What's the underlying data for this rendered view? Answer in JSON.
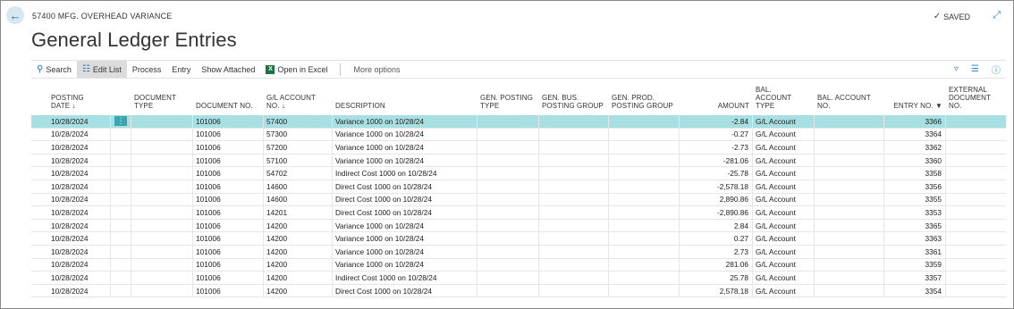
{
  "breadcrumb": "57400 MFG. OVERHEAD VARIANCE",
  "status": "SAVED",
  "page_title": "General Ledger Entries",
  "actions": {
    "search": "Search",
    "edit_list": "Edit List",
    "process": "Process",
    "entry": "Entry",
    "show_attached": "Show Attached",
    "open_in_excel": "Open in Excel",
    "more_options": "More options"
  },
  "columns": {
    "posting_date_1": "POSTING",
    "posting_date_2": "DATE ↓",
    "document_type_1": "DOCUMENT",
    "document_type_2": "TYPE",
    "document_no": "DOCUMENT NO.",
    "gl_account_1": "G/L ACCOUNT",
    "gl_account_2": "NO. ↓",
    "description": "DESCRIPTION",
    "gen_posting_1": "GEN. POSTING",
    "gen_posting_2": "TYPE",
    "gen_bus_1": "GEN. BUS.",
    "gen_bus_2": "POSTING GROUP",
    "gen_prod_1": "GEN. PROD.",
    "gen_prod_2": "POSTING GROUP",
    "amount": "AMOUNT",
    "bal_account_type_1": "BAL.",
    "bal_account_type_2": "ACCOUNT",
    "bal_account_type_3": "TYPE",
    "bal_account_no_1": "BAL. ACCOUNT",
    "bal_account_no_2": "NO.",
    "entry_no": "ENTRY NO.",
    "external_doc_1": "EXTERNAL",
    "external_doc_2": "DOCUMENT",
    "external_doc_3": "NO."
  },
  "rows": [
    {
      "posting_date": "10/28/2024",
      "document_type": "",
      "document_no": "101006",
      "gl_account": "57400",
      "description": "Variance 1000 on 10/28/24",
      "gen_posting_type": "",
      "gen_bus": "",
      "gen_prod": "",
      "amount": "-2.84",
      "bal_account_type": "G/L Account",
      "bal_account_no": "",
      "entry_no": "3366",
      "external_doc": ""
    },
    {
      "posting_date": "10/28/2024",
      "document_type": "",
      "document_no": "101006",
      "gl_account": "57300",
      "description": "Variance 1000 on 10/28/24",
      "gen_posting_type": "",
      "gen_bus": "",
      "gen_prod": "",
      "amount": "-0.27",
      "bal_account_type": "G/L Account",
      "bal_account_no": "",
      "entry_no": "3364",
      "external_doc": ""
    },
    {
      "posting_date": "10/28/2024",
      "document_type": "",
      "document_no": "101006",
      "gl_account": "57200",
      "description": "Variance 1000 on 10/28/24",
      "gen_posting_type": "",
      "gen_bus": "",
      "gen_prod": "",
      "amount": "-2.73",
      "bal_account_type": "G/L Account",
      "bal_account_no": "",
      "entry_no": "3362",
      "external_doc": ""
    },
    {
      "posting_date": "10/28/2024",
      "document_type": "",
      "document_no": "101006",
      "gl_account": "57100",
      "description": "Variance 1000 on 10/28/24",
      "gen_posting_type": "",
      "gen_bus": "",
      "gen_prod": "",
      "amount": "-281.06",
      "bal_account_type": "G/L Account",
      "bal_account_no": "",
      "entry_no": "3360",
      "external_doc": ""
    },
    {
      "posting_date": "10/28/2024",
      "document_type": "",
      "document_no": "101006",
      "gl_account": "54702",
      "description": "Indirect Cost 1000 on 10/28/24",
      "gen_posting_type": "",
      "gen_bus": "",
      "gen_prod": "",
      "amount": "-25.78",
      "bal_account_type": "G/L Account",
      "bal_account_no": "",
      "entry_no": "3358",
      "external_doc": ""
    },
    {
      "posting_date": "10/28/2024",
      "document_type": "",
      "document_no": "101006",
      "gl_account": "14600",
      "description": "Direct Cost 1000 on 10/28/24",
      "gen_posting_type": "",
      "gen_bus": "",
      "gen_prod": "",
      "amount": "-2,578.18",
      "bal_account_type": "G/L Account",
      "bal_account_no": "",
      "entry_no": "3356",
      "external_doc": ""
    },
    {
      "posting_date": "10/28/2024",
      "document_type": "",
      "document_no": "101006",
      "gl_account": "14600",
      "description": "Direct Cost 1000 on 10/28/24",
      "gen_posting_type": "",
      "gen_bus": "",
      "gen_prod": "",
      "amount": "2,890.86",
      "bal_account_type": "G/L Account",
      "bal_account_no": "",
      "entry_no": "3355",
      "external_doc": ""
    },
    {
      "posting_date": "10/28/2024",
      "document_type": "",
      "document_no": "101006",
      "gl_account": "14201",
      "description": "Direct Cost 1000 on 10/28/24",
      "gen_posting_type": "",
      "gen_bus": "",
      "gen_prod": "",
      "amount": "-2,890.86",
      "bal_account_type": "G/L Account",
      "bal_account_no": "",
      "entry_no": "3353",
      "external_doc": ""
    },
    {
      "posting_date": "10/28/2024",
      "document_type": "",
      "document_no": "101006",
      "gl_account": "14200",
      "description": "Variance 1000 on 10/28/24",
      "gen_posting_type": "",
      "gen_bus": "",
      "gen_prod": "",
      "amount": "2.84",
      "bal_account_type": "G/L Account",
      "bal_account_no": "",
      "entry_no": "3365",
      "external_doc": ""
    },
    {
      "posting_date": "10/28/2024",
      "document_type": "",
      "document_no": "101006",
      "gl_account": "14200",
      "description": "Variance 1000 on 10/28/24",
      "gen_posting_type": "",
      "gen_bus": "",
      "gen_prod": "",
      "amount": "0.27",
      "bal_account_type": "G/L Account",
      "bal_account_no": "",
      "entry_no": "3363",
      "external_doc": ""
    },
    {
      "posting_date": "10/28/2024",
      "document_type": "",
      "document_no": "101006",
      "gl_account": "14200",
      "description": "Variance 1000 on 10/28/24",
      "gen_posting_type": "",
      "gen_bus": "",
      "gen_prod": "",
      "amount": "2.73",
      "bal_account_type": "G/L Account",
      "bal_account_no": "",
      "entry_no": "3361",
      "external_doc": ""
    },
    {
      "posting_date": "10/28/2024",
      "document_type": "",
      "document_no": "101006",
      "gl_account": "14200",
      "description": "Variance 1000 on 10/28/24",
      "gen_posting_type": "",
      "gen_bus": "",
      "gen_prod": "",
      "amount": "281.06",
      "bal_account_type": "G/L Account",
      "bal_account_no": "",
      "entry_no": "3359",
      "external_doc": ""
    },
    {
      "posting_date": "10/28/2024",
      "document_type": "",
      "document_no": "101006",
      "gl_account": "14200",
      "description": "Indirect Cost 1000 on 10/28/24",
      "gen_posting_type": "",
      "gen_bus": "",
      "gen_prod": "",
      "amount": "25.78",
      "bal_account_type": "G/L Account",
      "bal_account_no": "",
      "entry_no": "3357",
      "external_doc": ""
    },
    {
      "posting_date": "10/28/2024",
      "document_type": "",
      "document_no": "101006",
      "gl_account": "14200",
      "description": "Direct Cost 1000 on 10/28/24",
      "gen_posting_type": "",
      "gen_bus": "",
      "gen_prod": "",
      "amount": "2,578.18",
      "bal_account_type": "G/L Account",
      "bal_account_no": "",
      "entry_no": "3354",
      "external_doc": ""
    }
  ],
  "selected_row_index": 0,
  "colors": {
    "selected_row": "#a7dfe3",
    "accent": "#2a6ebb",
    "row_menu_button": "#3aa6b0"
  },
  "icons": {
    "back": "arrow-left-icon",
    "saved": "checkmark-icon",
    "collapse": "collapse-icon",
    "search": "search-icon",
    "edit_list": "edit-list-icon",
    "excel": "excel-icon",
    "filter": "filter-icon",
    "list_view": "list-view-icon",
    "info": "info-icon",
    "row_menu": "more-vertical-icon",
    "sort_descending": "sort-descending-icon"
  }
}
